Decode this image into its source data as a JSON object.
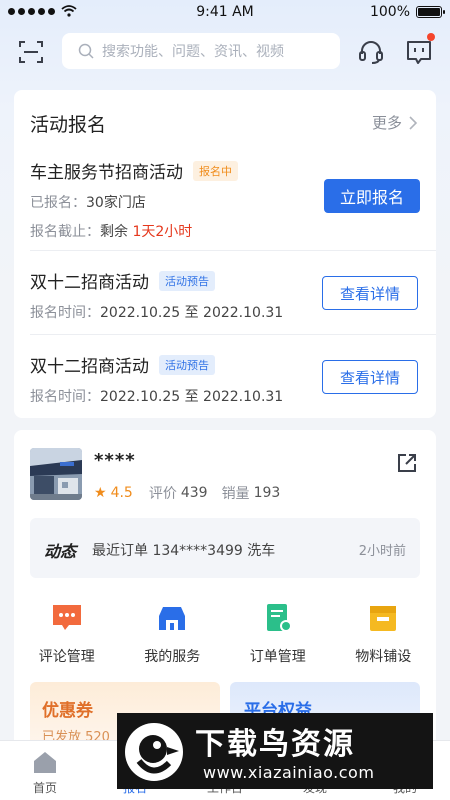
{
  "status_bar": {
    "time": "9:41 AM",
    "battery": "100%"
  },
  "topbar": {
    "search_placeholder": "搜索功能、问题、资讯、视频"
  },
  "activity": {
    "title": "活动报名",
    "more": "更多",
    "items": [
      {
        "title": "车主服务节招商活动",
        "tag": "报名中",
        "line1_label": "已报名：",
        "line1_value": "30家门店",
        "line2_label": "报名截止：",
        "line2_prefix": "剩余",
        "line2_value": "1天2小时",
        "button": "立即报名"
      },
      {
        "title": "双十二招商活动",
        "tag": "活动预告",
        "line1_label": "报名时间：",
        "line1_value": "2022.10.25 至 2022.10.31",
        "button": "查看详情"
      },
      {
        "title": "双十二招商活动",
        "tag": "活动预告",
        "line1_label": "报名时间：",
        "line1_value": "2022.10.25 至 2022.10.31",
        "button": "查看详情"
      }
    ]
  },
  "store": {
    "name": "****",
    "rating": "4.5",
    "reviews_label": "评价",
    "reviews": "439",
    "sales_label": "销量",
    "sales": "193",
    "dynamic_label": "动态",
    "dynamic_text": "最近订单 134****3499 洗车",
    "dynamic_time": "2小时前",
    "menu": [
      {
        "label": "评论管理",
        "icon": "comment-icon",
        "color": "#f26a3d"
      },
      {
        "label": "我的服务",
        "icon": "car-service-icon",
        "color": "#2a6ee8"
      },
      {
        "label": "订单管理",
        "icon": "order-icon",
        "color": "#2bbf8a"
      },
      {
        "label": "物料铺设",
        "icon": "material-icon",
        "color": "#f5b921"
      }
    ],
    "coupon_title": "优惠券",
    "coupon_sub": "已发放 520",
    "rights_title": "平台权益"
  },
  "tabbar": {
    "tabs": [
      {
        "label": "首页"
      },
      {
        "label": "报名"
      },
      {
        "label": "工作台"
      },
      {
        "label": "发现"
      },
      {
        "label": "我的"
      }
    ]
  },
  "watermark": {
    "title": "下载鸟资源",
    "url": "www.xiazainiao.com"
  },
  "colors": {
    "accent": "#2a6ee8",
    "alert": "#e5381d",
    "tag_orange": "#f08c1c"
  }
}
